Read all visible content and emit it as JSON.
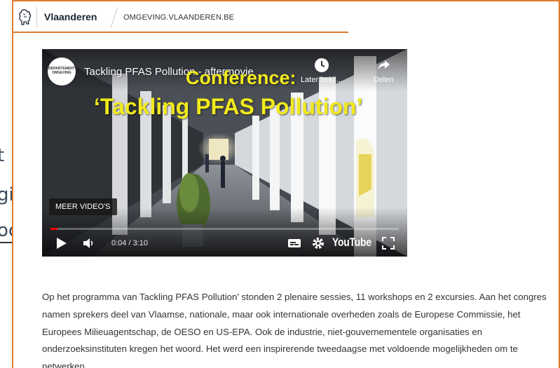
{
  "background_page": {
    "line1": "t",
    "line2": "gi",
    "line3": "oc"
  },
  "header": {
    "brand": "Vlaanderen",
    "domain": "OMGEVING.VLAANDEREN.BE"
  },
  "video": {
    "channel_avatar_text": "DEPARTEMENT OMGEVING",
    "title": "Tackling PFAS Pollution - aftermovie",
    "overlay_line1": "Conference:",
    "overlay_line2": "‘Tackling PFAS Pollution’",
    "watch_later_label": "Later bekij...",
    "share_label": "Delen",
    "more_videos_label": "MEER VIDEO'S",
    "time": "0:04 / 3:10",
    "progress_fraction": 0.021,
    "platform_logo": "YouTube",
    "icons": {
      "watch_later": "clock-icon",
      "share": "share-arrow-icon",
      "play": "play-icon",
      "volume": "volume-icon",
      "captions": "subtitles-icon",
      "settings": "gear-icon",
      "fullscreen": "fullscreen-icon"
    }
  },
  "paragraph": "Op het programma van Tackling PFAS Pollution’ stonden 2 plenaire sessies, 11 workshops en 2 excursies. Aan het congres namen sprekers deel van Vlaamse, nationale, maar ook internationale overheden zoals de Europese Commissie, het Europees Milieuagentschap, de OESO en US-EPA. Ook de industrie, niet-gouvernementele organisaties en onderzoeksinstituten kregen het woord. Het werd een inspirerende tweedaagse met voldoende mogelijkheden om te netwerken.",
  "colors": {
    "accent_orange": "#e07a2e",
    "overlay_yellow": "#f1ea1b",
    "progress_red": "#ff0000",
    "text": "#333333"
  }
}
